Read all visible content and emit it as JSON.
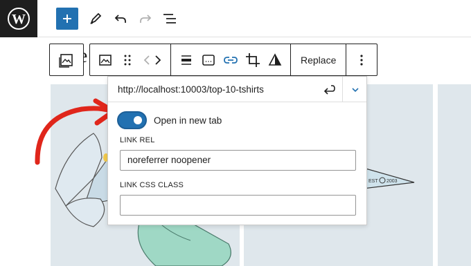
{
  "colors": {
    "accent": "#2271b1",
    "dark": "#1e1e1e",
    "arrow": "#e0261b",
    "tile": "#dfe7ec"
  },
  "topbar": {
    "logo_icon": "wordpress-icon",
    "icons": [
      "plus-icon",
      "pencil-icon",
      "undo-icon",
      "redo-icon",
      "list-view-icon"
    ]
  },
  "canvas": {
    "heading_peek": "e"
  },
  "block_toolbar": {
    "icons": [
      "image-icon",
      "drag-handle-icon",
      "move-arrows-icon",
      "align-icon",
      "caption-icon",
      "link-icon",
      "crop-icon",
      "filter-icon",
      "more-options-icon"
    ],
    "replace_label": "Replace"
  },
  "link_popover": {
    "url": "http://localhost:10003/top-10-tshirts",
    "open_new_tab_label": "Open in new tab",
    "open_new_tab_enabled": true,
    "link_rel_label": "LINK REL",
    "link_rel_value": "noreferrer noopener",
    "link_css_label": "LINK CSS CLASS",
    "link_css_value": ""
  }
}
